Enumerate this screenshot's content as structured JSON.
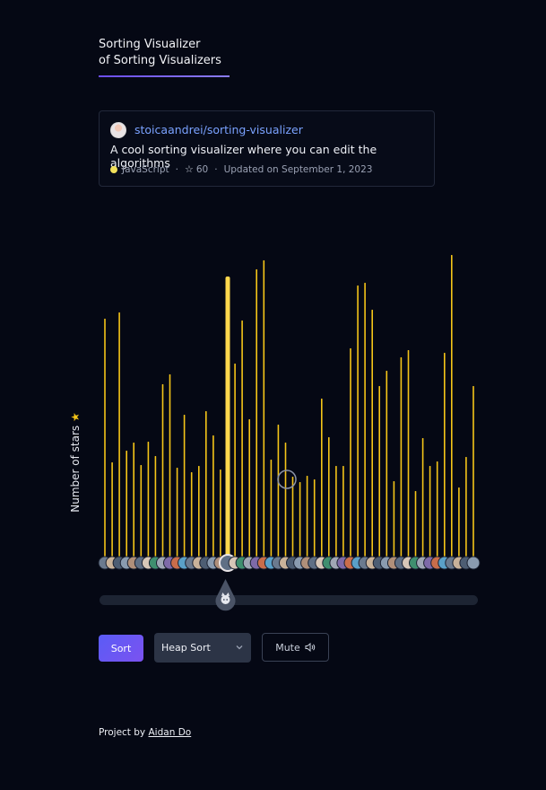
{
  "header": {
    "title_line1": "Sorting Visualizer",
    "title_line2": "of Sorting Visualizers"
  },
  "repo_card": {
    "name": "stoicaandrei/sorting-visualizer",
    "description": "A cool sorting visualizer where you can edit the algorithms",
    "language": "JavaScript",
    "language_color": "#f1e05a",
    "separator": "·",
    "stars": "60",
    "updated": "Updated on September 1, 2023"
  },
  "chart": {
    "ylabel": "Number of stars",
    "bar_color": "#f5c518",
    "active_index": 17
  },
  "chart_data": {
    "type": "bar",
    "values": [
      265,
      105,
      272,
      118,
      127,
      102,
      128,
      112,
      192,
      203,
      99,
      158,
      94,
      101,
      162,
      135,
      97,
      312,
      215,
      263,
      153,
      320,
      330,
      108,
      147,
      127,
      89,
      83,
      90,
      86,
      176,
      133,
      101,
      101,
      232,
      302,
      305,
      275,
      190,
      207,
      84,
      222,
      230,
      73,
      132,
      101,
      106,
      227,
      336,
      77,
      111,
      190
    ]
  },
  "controls": {
    "sort_label": "Sort",
    "algorithm_selected": "Heap Sort",
    "mute_label": "Mute"
  },
  "footer": {
    "prefix": "Project by",
    "author": "Aidan Do"
  }
}
